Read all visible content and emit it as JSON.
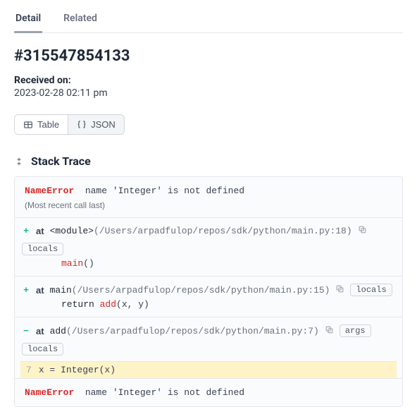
{
  "tabs": {
    "detail": "Detail",
    "related": "Related"
  },
  "recordId": "#315547854133",
  "received": {
    "label": "Received on:",
    "value": "2023-02-28 02:11 pm"
  },
  "toggle": {
    "table": "Table",
    "json": "JSON"
  },
  "section": {
    "title": "Stack Trace"
  },
  "error": {
    "name": "NameError",
    "msg": "name 'Integer' is not defined",
    "mostRecent": "(Most recent call last)"
  },
  "pills": {
    "locals": "locals",
    "args": "args"
  },
  "at": "at",
  "frames": [
    {
      "expander": "+",
      "func": "<module>",
      "path": "(/Users/arpadfulop/repos/sdk/python/main.py:18)",
      "code_prefix": "",
      "code_call": "main",
      "code_suffix": "()",
      "show_args": false
    },
    {
      "expander": "+",
      "func": "main",
      "path": "(/Users/arpadfulop/repos/sdk/python/main.py:15)",
      "code_prefix": "return ",
      "code_call": "add",
      "code_suffix": "(x, y)",
      "show_args": false
    },
    {
      "expander": "−",
      "func": "add",
      "path": "(/Users/arpadfulop/repos/sdk/python/main.py:7)",
      "lineno": "7",
      "highlight": "x = Integer(x)",
      "show_args": true
    }
  ]
}
